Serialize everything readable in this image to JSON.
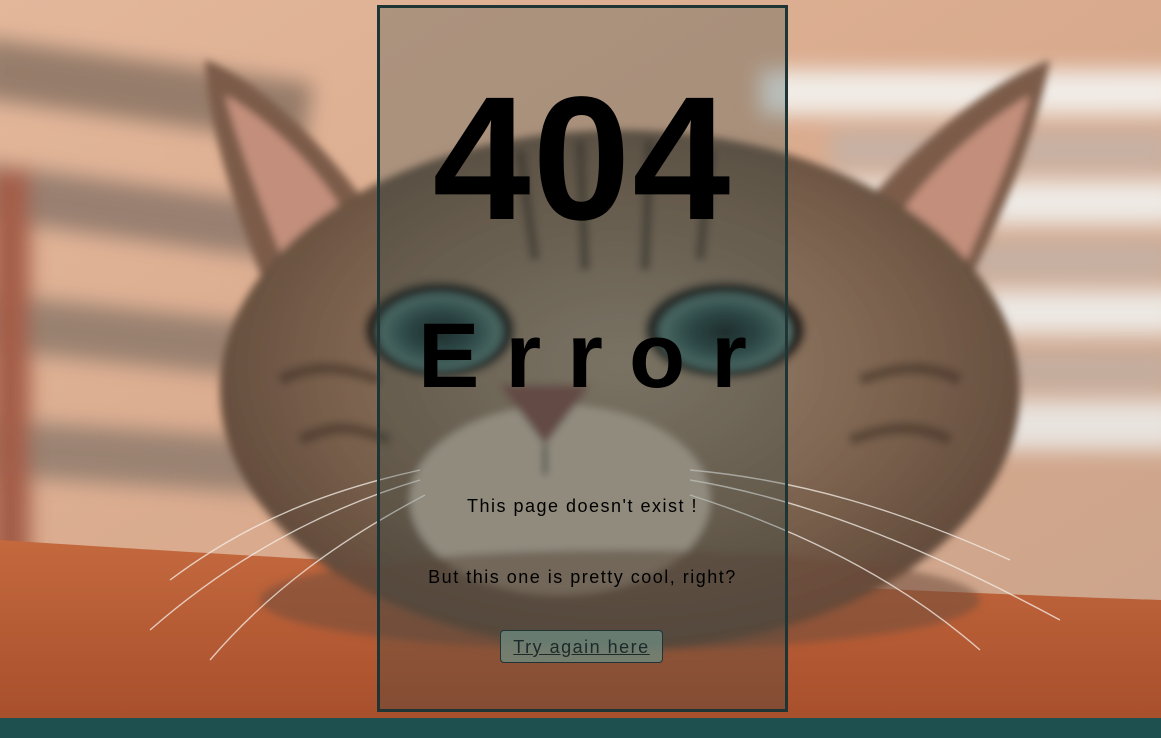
{
  "error_card": {
    "code": "404",
    "title": "Error",
    "message_primary": "This page doesn't exist !",
    "message_secondary": "But this one is pretty cool, right?",
    "retry_link_label": "Try again here"
  },
  "background": {
    "subject": "cat-photo"
  },
  "colors": {
    "footer": "#1e5050",
    "card_border": "#1f3535",
    "text": "#000000",
    "button_fill": "#6e8c82"
  }
}
